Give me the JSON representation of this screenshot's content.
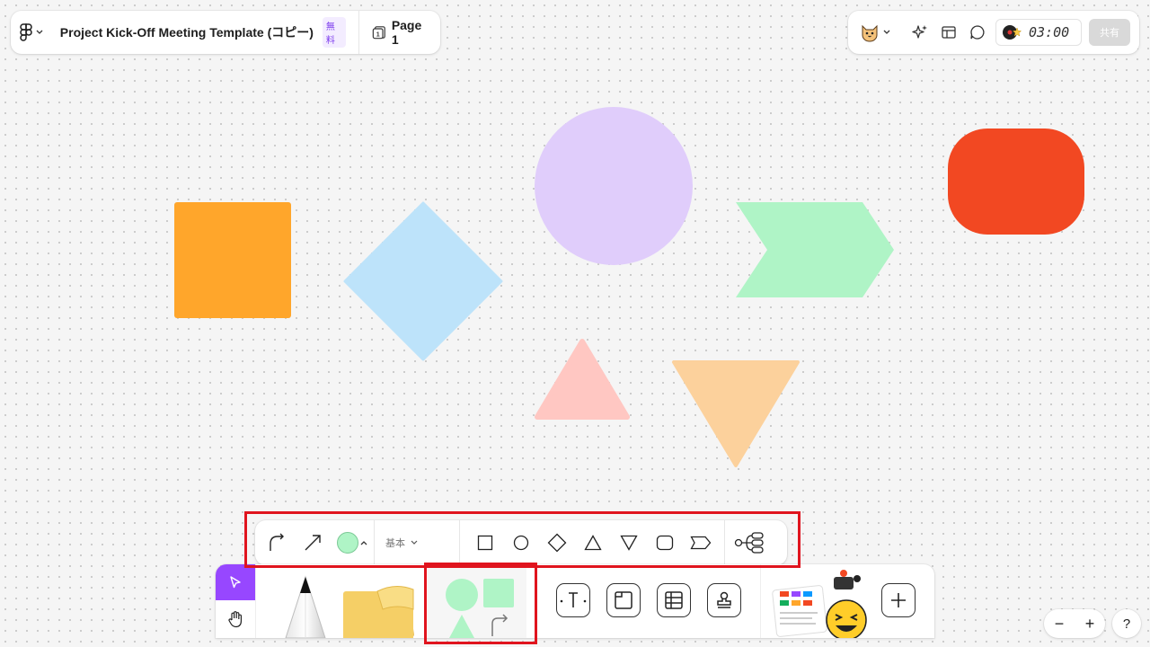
{
  "header": {
    "document_title": "Project Kick-Off Meeting Template (コピー)",
    "plan_badge": "無料",
    "page_label": "Page 1",
    "page_number": "1"
  },
  "topbar_right": {
    "timer": "03:00",
    "share_label": "共有"
  },
  "canvas": {
    "shapes": [
      {
        "kind": "square",
        "color": "#ffa62b"
      },
      {
        "kind": "diamond",
        "color": "#bde3fa"
      },
      {
        "kind": "circle",
        "color": "#e0cdfb"
      },
      {
        "kind": "chevron",
        "color": "#aff4c6"
      },
      {
        "kind": "rounded-rectangle",
        "color": "#f24822"
      },
      {
        "kind": "triangle",
        "color": "#ffc7c2"
      },
      {
        "kind": "inverted-triangle",
        "color": "#fcd19c"
      }
    ]
  },
  "shape_toolbar": {
    "shape_set_label": "基本",
    "selected_fill_color": "#aff4c6",
    "tools": [
      "elbow-connector",
      "arrow",
      "fill-color",
      "square",
      "circle",
      "diamond",
      "triangle",
      "inverted-triangle",
      "rounded-rectangle",
      "chevron",
      "mind-map"
    ]
  },
  "bottom_toolbar": {
    "tools": [
      "move",
      "hand",
      "marker",
      "sticky-note",
      "shapes",
      "text",
      "section",
      "table",
      "stamp",
      "widgets",
      "more"
    ]
  },
  "zoom": {
    "zoom_out": "−",
    "zoom_in": "+",
    "help": "?"
  },
  "colors": {
    "accent": "#9747ff",
    "highlight": "#e0141e",
    "badge": "#7c3aed"
  }
}
